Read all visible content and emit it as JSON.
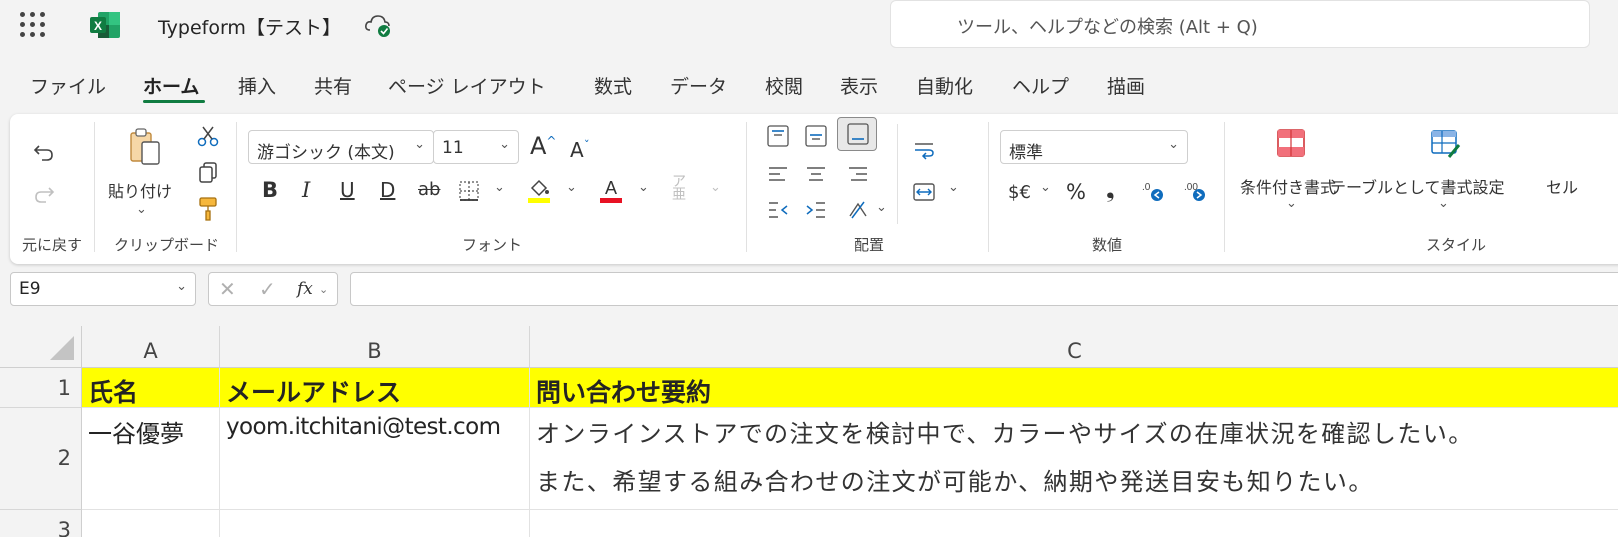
{
  "titlebar": {
    "doc_title": "Typeform【テスト】",
    "search_placeholder": "ツール、ヘルプなどの検索 (Alt + Q)"
  },
  "menu": {
    "tabs": [
      "ファイル",
      "ホーム",
      "挿入",
      "共有",
      "ページ レイアウト",
      "数式",
      "データ",
      "校閲",
      "表示",
      "自動化",
      "ヘルプ",
      "描画"
    ],
    "active": "ホーム"
  },
  "ribbon": {
    "undo_group": "元に戻す",
    "clipboard": {
      "paste": "貼り付け",
      "group": "クリップボード"
    },
    "font": {
      "name": "游ゴシック (本文)",
      "size": "11",
      "group": "フォント"
    },
    "alignment": {
      "group": "配置"
    },
    "number": {
      "format": "標準",
      "group": "数値",
      "currency": "$€",
      "percent": "%",
      "comma": "❟"
    },
    "styles": {
      "conditional": "条件付き書式",
      "table": "テーブルとして書式設定",
      "cell": "セル",
      "group": "スタイル"
    },
    "colors": {
      "accent": "#107c41",
      "highlight": "#ffff00",
      "font_color": "#e81123"
    }
  },
  "formula_bar": {
    "name_box": "E9",
    "fx": "fx",
    "value": ""
  },
  "sheet": {
    "columns": [
      "A",
      "B",
      "C"
    ],
    "rows": [
      "1",
      "2",
      "3"
    ],
    "header": [
      "氏名",
      "メールアドレス",
      "問い合わせ要約"
    ],
    "row2": {
      "name": "一谷優夢",
      "email": "yoom.itchitani@test.com",
      "summary_line1": "オンラインストアでの注文を検討中で、カラーやサイズの在庫状況を確認したい。",
      "summary_line2": "また、希望する組み合わせの注文が可能か、納期や発送目安も知りたい。"
    }
  }
}
